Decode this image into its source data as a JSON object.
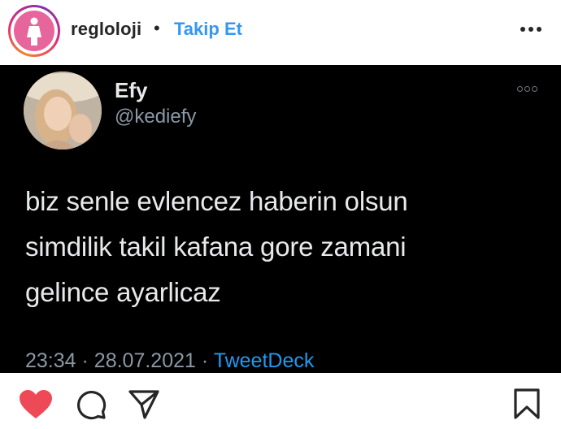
{
  "header": {
    "username": "reglolojі",
    "separator": "•",
    "follow_label": "Takip Et",
    "more_icon": "more-horizontal-icon"
  },
  "tweet": {
    "display_name": "Efy",
    "handle": "@kediefy",
    "text": "biz senle evlencez haberin olsun\nsimdilik takil kafana gore zamani\ngelince ayarlicaz",
    "time": "23:34",
    "meta_sep": "·",
    "date": "28.07.2021",
    "source": "TweetDeck"
  },
  "actions": {
    "like_icon": "heart-filled-icon",
    "comment_icon": "comment-icon",
    "share_icon": "share-icon",
    "save_icon": "bookmark-icon",
    "like_color": "#ed4956"
  }
}
